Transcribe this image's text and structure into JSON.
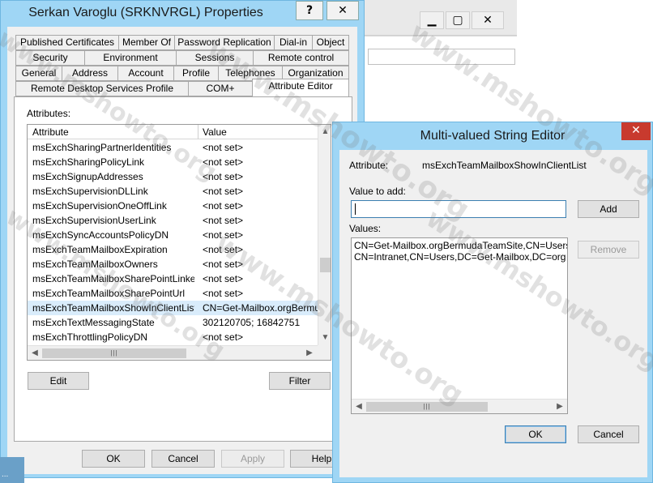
{
  "properties_window": {
    "title": "Serkan Varoglu (SRKNVRGL) Properties",
    "help_glyph": "?",
    "close_glyph": "✕",
    "tabs_row1": [
      "Published Certificates",
      "Member Of",
      "Password Replication",
      "Dial-in",
      "Object"
    ],
    "tabs_row2": [
      "Security",
      "Environment",
      "Sessions",
      "Remote control"
    ],
    "tabs_row3": [
      "General",
      "Address",
      "Account",
      "Profile",
      "Telephones",
      "Organization"
    ],
    "tabs_row4": [
      "Remote Desktop Services Profile",
      "COM+",
      "Attribute Editor"
    ],
    "active_tab": "Attribute Editor",
    "attributes_label": "Attributes:",
    "columns": [
      "Attribute",
      "Value"
    ],
    "rows": [
      {
        "attribute": "msExchSharingPartnerIdentities",
        "value": "<not set>"
      },
      {
        "attribute": "msExchSharingPolicyLink",
        "value": "<not set>"
      },
      {
        "attribute": "msExchSignupAddresses",
        "value": "<not set>"
      },
      {
        "attribute": "msExchSupervisionDLLink",
        "value": "<not set>"
      },
      {
        "attribute": "msExchSupervisionOneOffLink",
        "value": "<not set>"
      },
      {
        "attribute": "msExchSupervisionUserLink",
        "value": "<not set>"
      },
      {
        "attribute": "msExchSyncAccountsPolicyDN",
        "value": "<not set>"
      },
      {
        "attribute": "msExchTeamMailboxExpiration",
        "value": "<not set>"
      },
      {
        "attribute": "msExchTeamMailboxOwners",
        "value": "<not set>"
      },
      {
        "attribute": "msExchTeamMailboxSharePointLinke...",
        "value": "<not set>"
      },
      {
        "attribute": "msExchTeamMailboxSharePointUrl",
        "value": "<not set>"
      },
      {
        "attribute": "msExchTeamMailboxShowInClientList",
        "value": "CN=Get-Mailbox.orgBermud"
      },
      {
        "attribute": "msExchTextMessagingState",
        "value": "302120705; 16842751"
      },
      {
        "attribute": "msExchThrottlingPolicyDN",
        "value": "<not set>"
      }
    ],
    "selected_row": 11,
    "edit_label": "Edit",
    "filter_label": "Filter",
    "ok_label": "OK",
    "cancel_label": "Cancel",
    "apply_label": "Apply",
    "help_label": "Help"
  },
  "editor": {
    "title": "Multi-valued String Editor",
    "close_glyph": "✕",
    "attribute_label": "Attribute:",
    "attribute_value": "msExchTeamMailboxShowInClientList",
    "value_to_add_label": "Value to add:",
    "value_to_add": "",
    "add_label": "Add",
    "values_label": "Values:",
    "values": [
      "CN=Get-Mailbox.orgBermudaTeamSite,CN=Users,DC",
      "CN=Intranet,CN=Users,DC=Get-Mailbox,DC=org"
    ],
    "remove_label": "Remove",
    "ok_label": "OK",
    "cancel_label": "Cancel"
  },
  "background_window": {
    "minimize_glyph": "▁",
    "maximize_glyph": "▢",
    "close_glyph": "✕"
  },
  "taskbar": {
    "label": "..."
  },
  "watermark": "www.mshowto.org",
  "scroll_glyphs": {
    "up": "▲",
    "down": "▼",
    "left": "◀",
    "right": "▶",
    "grip": "|||"
  },
  "colors": {
    "title_bar": "#9fd6f5",
    "close_red": "#c83a2e",
    "selection": "#d9ecfb"
  }
}
